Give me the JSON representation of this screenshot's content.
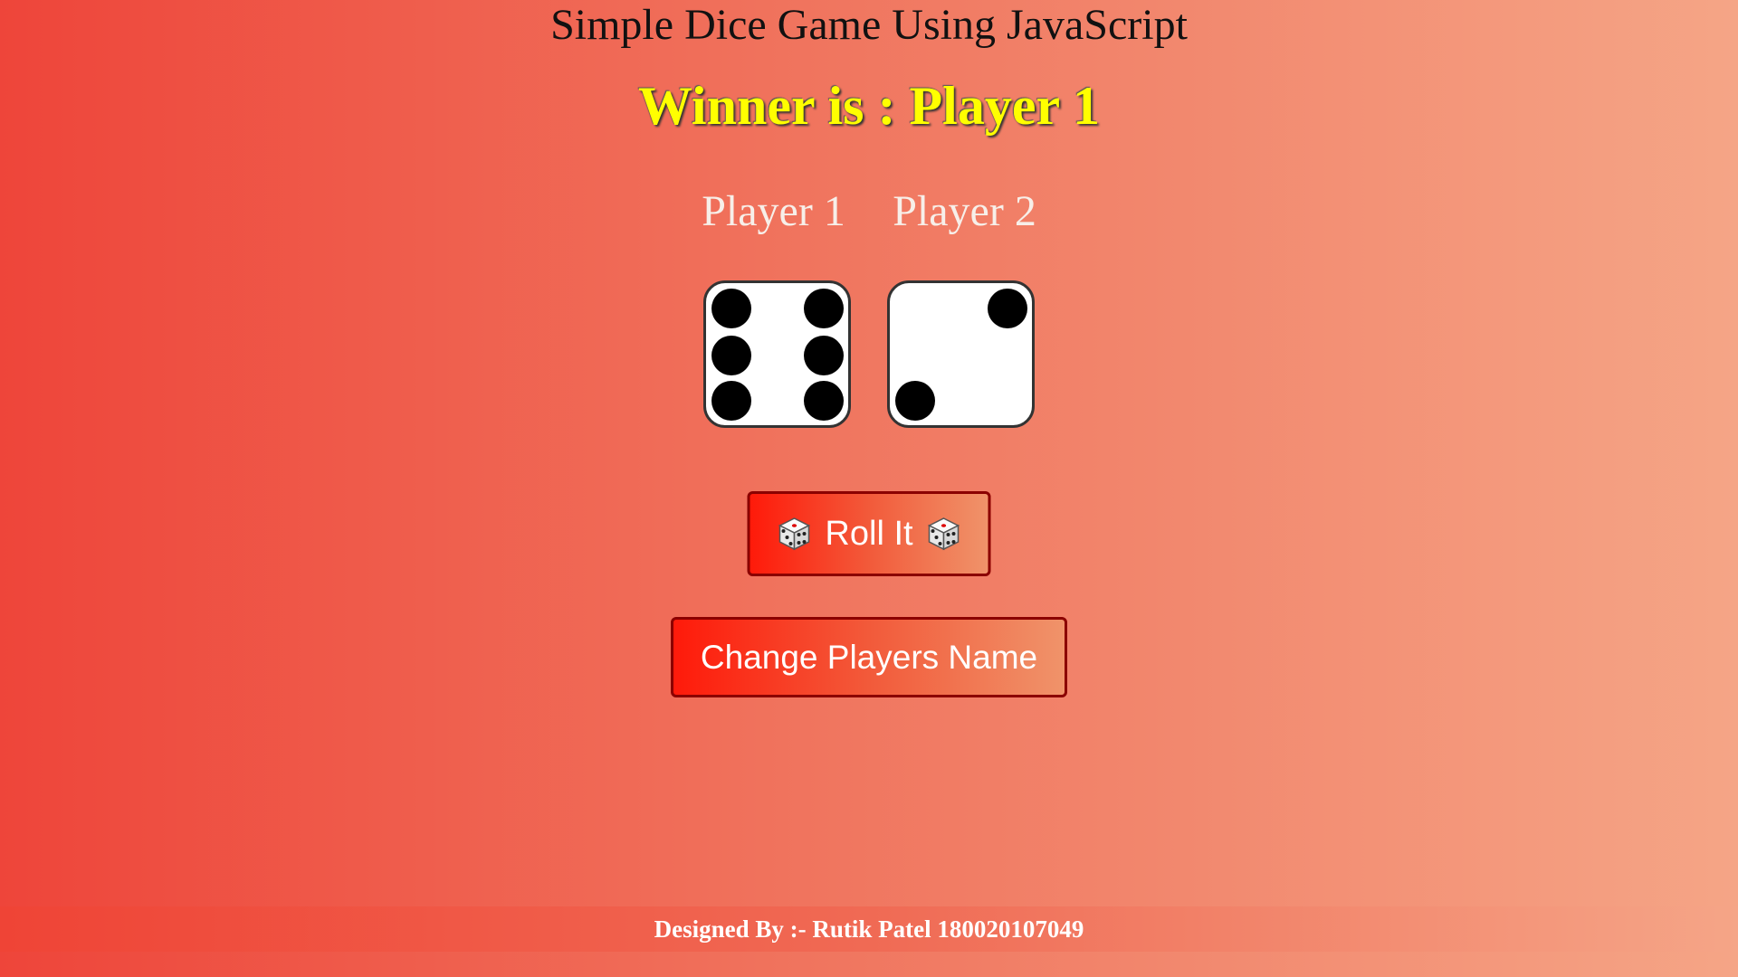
{
  "page": {
    "title": "Simple Dice Game Using JavaScript",
    "winner_text": "Winner is : Player 1"
  },
  "players": [
    {
      "name": "Player 1",
      "die_value": 6
    },
    {
      "name": "Player 2",
      "die_value": 2
    }
  ],
  "buttons": {
    "roll_label": "Roll It",
    "change_names_label": "Change Players Name"
  },
  "footer": {
    "text": "Designed By :- Rutik Patel 180020107049"
  },
  "colors": {
    "winner": "#ffff00",
    "button_border": "#8b0000"
  },
  "icons": {
    "roll_left": "dice-icon",
    "roll_right": "dice-icon"
  }
}
